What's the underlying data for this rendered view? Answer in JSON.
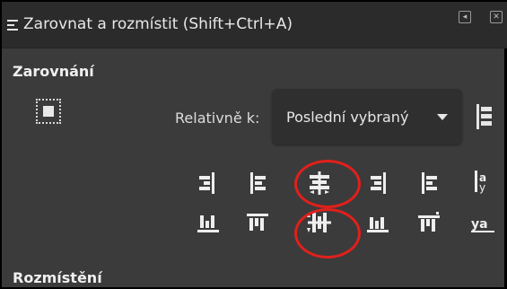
{
  "window": {
    "title": "Zarovnat a rozmístit (Shift+Ctrl+A)",
    "menu_icon": "menu-grip-icon",
    "detach_icon": "detach-icon",
    "close_icon": "close-icon"
  },
  "align_section": {
    "heading": "Zarovnání",
    "selection_icon": "selection-as-group-icon",
    "relative_label": "Relativně k:",
    "relative_value": "Poslední vybraný",
    "treat_as_group_icon": "align-options-icon",
    "row1": [
      {
        "name": "align-right-edges-to-left-icon"
      },
      {
        "name": "align-left-edges-icon"
      },
      {
        "name": "center-on-vertical-axis-icon"
      },
      {
        "name": "align-right-edges-icon"
      },
      {
        "name": "align-left-edges-to-right-icon"
      },
      {
        "name": "align-baseline-text-icon"
      }
    ],
    "row2": [
      {
        "name": "align-bottom-edges-to-top-icon"
      },
      {
        "name": "align-top-edges-icon"
      },
      {
        "name": "center-on-horizontal-axis-icon"
      },
      {
        "name": "align-bottom-edges-icon"
      },
      {
        "name": "align-top-edges-to-bottom-icon"
      },
      {
        "name": "align-baseline-anchor-icon"
      }
    ],
    "baseline_glyphs": {
      "top": "a",
      "bottom": "ya"
    }
  },
  "distribute_section": {
    "heading": "Rozmístění"
  },
  "annotations": {
    "highlight_color": "#e0201c"
  }
}
